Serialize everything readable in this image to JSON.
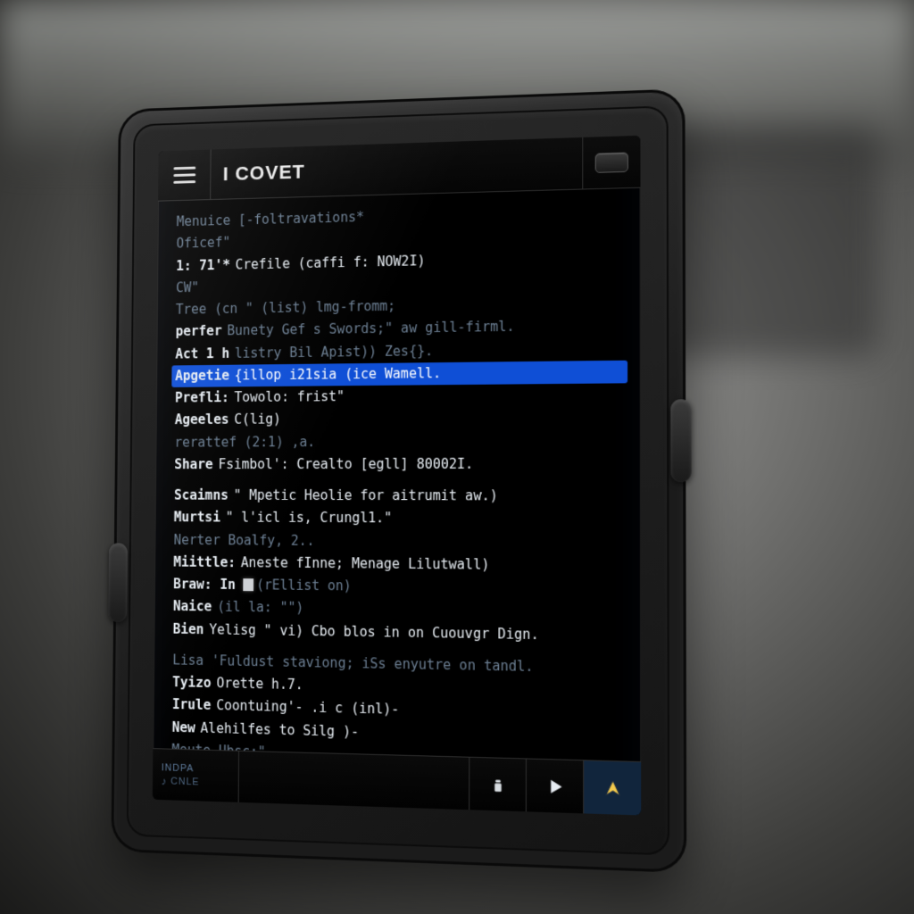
{
  "header": {
    "title": "I COVET"
  },
  "nav": {
    "tag_top": "INDPA",
    "tag_bottom": "CNLE"
  },
  "selected_index": 7,
  "lines": [
    {
      "style": "dim",
      "lead": "",
      "text": "Menuice [-foltravations*"
    },
    {
      "style": "dim",
      "lead": "",
      "text": "Oficef\""
    },
    {
      "style": "bright",
      "lead": "1: 71'*",
      "text": "Crefile (caffi f: NOW2I)"
    },
    {
      "style": "dim",
      "lead": "",
      "text": "CW\""
    },
    {
      "style": "dim",
      "lead": "",
      "text": "Tree (cn \" (list) lmg-fromm;"
    },
    {
      "style": "dim",
      "lead": "perfer",
      "text": "Bunety Gef s Swords;\" aw gill-firml."
    },
    {
      "style": "dim",
      "lead": "Act 1 h",
      "text": "listry Bil Apist)) Zes{}."
    },
    {
      "style": "sel",
      "lead": "Apgetie",
      "text": "{illop i21sia (ice Wamell."
    },
    {
      "style": "bright",
      "lead": "Prefli:",
      "text": "Towolo: frist\""
    },
    {
      "style": "bright",
      "lead": "Ageeles",
      "text": "C(lig)"
    },
    {
      "style": "dim",
      "lead": "",
      "text": "rerattef (2:1) ,a."
    },
    {
      "style": "bright",
      "lead": "Share",
      "text": "Fsimbol': Crealto [egll] 80002I."
    },
    {
      "style": "gap"
    },
    {
      "style": "bright group",
      "lead": "Scaimns",
      "text": "\" Mpetic Heolie for aitrumit aw.)"
    },
    {
      "style": "bright",
      "lead": "Murtsi",
      "text": "\" l'icl is, Crungl1.\""
    },
    {
      "style": "dim",
      "lead": "",
      "text": "Nerter Boalfy, 2.."
    },
    {
      "style": "bright",
      "lead": "Miittle:",
      "text": "Aneste fInne; Menage Lilutwall)"
    },
    {
      "style": "dim",
      "lead": "Braw: In",
      "text": "",
      "cursor": true,
      "tail": "(rEllist on)"
    },
    {
      "style": "dim",
      "lead": "Naice",
      "text": "(il la: \"\")"
    },
    {
      "style": "bright",
      "lead": "Bien",
      "text": "Yelisg \" vi) Cbo blos in on Cuouvgr Dign."
    },
    {
      "style": "gap"
    },
    {
      "style": "dim group",
      "lead": "",
      "text": "Lisa 'Fuldust staviong; iSs enyutre on tandl."
    },
    {
      "style": "bright",
      "lead": "Tyizo",
      "text": "Orette h.7."
    },
    {
      "style": "bright",
      "lead": "Irule",
      "text": "Coontuing'- .i c (inl)-"
    },
    {
      "style": "bright",
      "lead": "New",
      "text": "Alehilfes to Silg )-"
    },
    {
      "style": "dim",
      "lead": "",
      "text": "Moute Ubsc:\""
    }
  ]
}
